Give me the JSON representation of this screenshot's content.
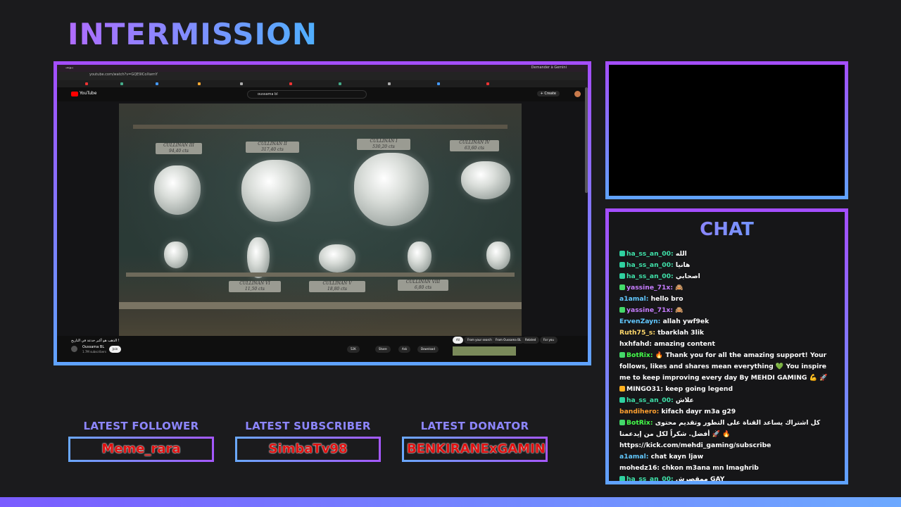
{
  "title": "INTERMISSION",
  "capture": {
    "tab_title": "يـوسـ",
    "tab_right": "Demander à Gemini",
    "url": "youtube.com/watch?v=GQE9lCoXwmY",
    "yt_logo": "YouTube",
    "search": "oussama bl",
    "create": "+ Create",
    "plaques": [
      "CULLINAN III",
      "CULLINAN II",
      "CULLINAN I",
      "CULLINAN IV",
      "CULLINAN VI",
      "CULLINAN V",
      "CULLINAN VIII"
    ],
    "plaque_weights": [
      "94,40 cts",
      "317,40 cts",
      "530,20 cts",
      "63,60 cts",
      "11,50 cts",
      "18,80 cts",
      "6,80 cts"
    ],
    "video_title": "الذهب هو أكبر خدعة في التاريخ !",
    "channel_name": "Oussama BL",
    "channel_subs": "1.7M subscribers",
    "join": "Join",
    "like_count": "52K",
    "share": "Share",
    "ask": "Ask",
    "download": "Download",
    "chips": [
      "All",
      "From your search",
      "From Oussama BL",
      "Related",
      "For you"
    ]
  },
  "latest": {
    "follower_label": "LATEST FOLLOWER",
    "follower": "Meme_rara",
    "subscriber_label": "LATEST SUBSCRIBER",
    "subscriber": "SimbaTv98",
    "donator_label": "LATEST DONATOR",
    "donator": "BENKIRANExGAMING"
  },
  "chat": {
    "title": "CHAT",
    "messages": [
      {
        "badge": "#2fd1a0",
        "user": "ha_ss_an_00:",
        "color": "#3fe0a8",
        "text": "الله"
      },
      {
        "badge": "#2fd1a0",
        "user": "ha_ss_an_00:",
        "color": "#3fe0a8",
        "text": "هانيا"
      },
      {
        "badge": "#2fd1a0",
        "user": "ha_ss_an_00:",
        "color": "#3fe0a8",
        "text": "اصحابي"
      },
      {
        "badge": "#44d86a",
        "user": "yassine_71x:",
        "color": "#c77dff",
        "text": "🙈"
      },
      {
        "badge": "",
        "user": "a1amal:",
        "color": "#62c8ff",
        "text": "hello bro"
      },
      {
        "badge": "#44d86a",
        "user": "yassine_71x:",
        "color": "#c77dff",
        "text": "🙈"
      },
      {
        "badge": "",
        "user": "ErvenZayn:",
        "color": "#62c8ff",
        "text": "allah ywf9ek"
      },
      {
        "badge": "",
        "user": "Ruth75_s:",
        "color": "#ffd86b",
        "text": "tbarklah 3lik"
      },
      {
        "badge": "",
        "user": "hxhfahd:",
        "color": "#ffffff",
        "text": "amazing content"
      },
      {
        "badge": "#44d86a",
        "user": "BotRix:",
        "color": "#44ff4a",
        "text": "🔥 Thank you for all the amazing support! Your follows, likes and shares mean everything 💚 You inspire me to keep improving every day By MEHDI GAMING 💪 🚀"
      },
      {
        "badge": "#ffb020",
        "user": "MINGO31:",
        "color": "#ffffff",
        "text": "keep going legend"
      },
      {
        "badge": "#2fd1a0",
        "user": "ha_ss_an_00:",
        "color": "#3fe0a8",
        "text": "علاش"
      },
      {
        "badge": "",
        "user": "bandihero:",
        "color": "#ffa030",
        "text": "kifach dayr m3a g29"
      },
      {
        "badge": "#44d86a",
        "user": "BotRix:",
        "color": "#44ff4a",
        "text": "كل اشتراك يساعد القناة على التطور وتقديم محتوى أفضل. شكراً لكل من إيدعمنا 🚀 🔥 https://kick.com/mehdi_gaming/subscribe"
      },
      {
        "badge": "",
        "user": "a1amal:",
        "color": "#62c8ff",
        "text": "chat kayn ljaw"
      },
      {
        "badge": "",
        "user": "mohedz16:",
        "color": "#ffffff",
        "text": "chkon m3ana mn lmaghrib"
      },
      {
        "badge": "#2fd1a0",
        "user": "ha_ss_an_00:",
        "color": "#3fe0a8",
        "text": "ممقصرش GAY"
      }
    ]
  }
}
